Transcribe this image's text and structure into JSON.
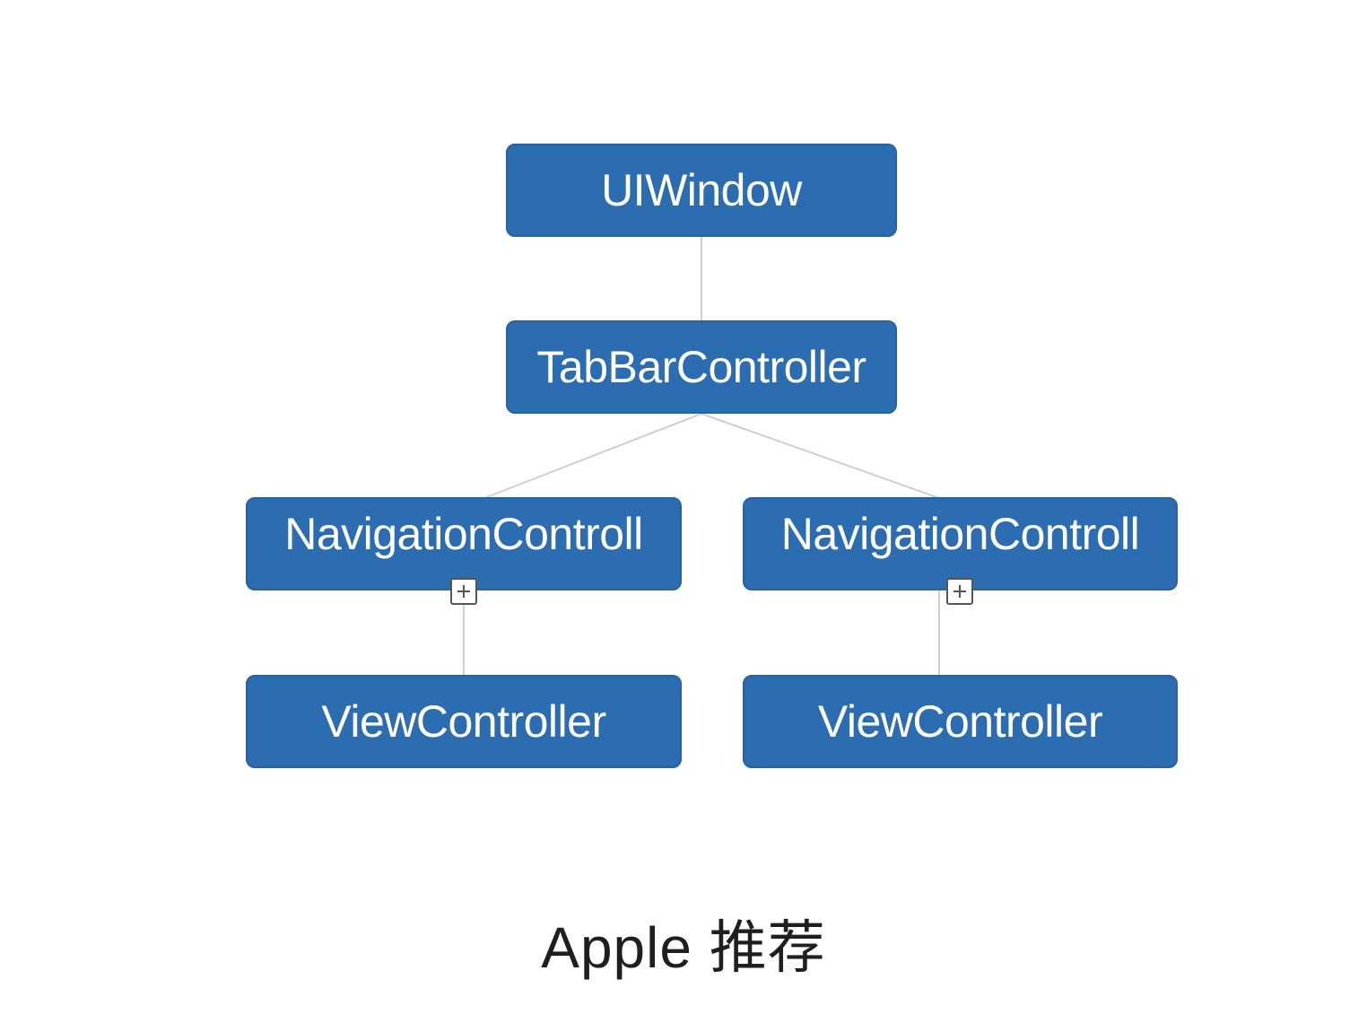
{
  "diagram": {
    "nodes": {
      "window": "UIWindow",
      "tabbar": "TabBarController",
      "nav_left": "NavigationControll",
      "nav_right": "NavigationControll",
      "vc_left": "ViewController",
      "vc_right": "ViewController"
    },
    "caption": "Apple 推荐"
  },
  "colors": {
    "node_fill": "#2c6cb0",
    "node_text": "#ffffff",
    "connector": "#cfcfcf",
    "caption": "#1f1f1f"
  }
}
